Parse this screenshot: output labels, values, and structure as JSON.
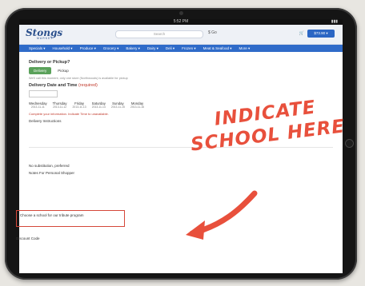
{
  "browser": {
    "time": "5:52 PM",
    "battery": "▮▮▮"
  },
  "header": {
    "logo": "Stongs",
    "logo_sub": "MARKET",
    "search_placeholder": "Search",
    "go_label": "$ Go",
    "cart_label": "$73.90 ▾"
  },
  "nav": {
    "items": [
      "Specials ▾",
      "Household ▾",
      "Produce ▾",
      "Grocery ▾",
      "Bakery ▾",
      "Dairy ▾",
      "Deli ▾",
      "Frozen ▾",
      "Meat & Seafood ▾",
      "More ▾"
    ]
  },
  "delivery": {
    "title": "Delivery or Pickup?",
    "delivery_btn": "Delivery",
    "pickup_btn": "Pickup",
    "note": "We'll call this moment, only one store (Northwoods) is available for pickup",
    "datetime_title": "Delivery Date and Time",
    "required": "(required)",
    "days": [
      {
        "name": "Wednesday",
        "date": "2013-11-11"
      },
      {
        "name": "Thursday",
        "date": "2013-11-12"
      },
      {
        "name": "Friday",
        "date": "2013-11-13"
      },
      {
        "name": "Saturday",
        "date": "2013-11-14"
      },
      {
        "name": "Sunday",
        "date": "2013-11-15"
      },
      {
        "name": "Monday",
        "date": "2013-11-16"
      }
    ],
    "warning": "Complete your information. Indicate Time to unavailable.",
    "instructions_label": "Delivery Instructions"
  },
  "notes": {
    "substitution_label": "No substitution, preferred",
    "shopper_notes_label": "Notes For Personal Shopper"
  },
  "school": {
    "label": "Choose a school for our tribute program"
  },
  "discount": {
    "label": "Discount Code"
  },
  "overlay": {
    "line1": "INDICATE",
    "line2": "SCHOOL HERE"
  },
  "colors": {
    "nav": "#2f6bc9",
    "accent_red": "#e8503c",
    "delivery_green": "#5aa15a"
  }
}
